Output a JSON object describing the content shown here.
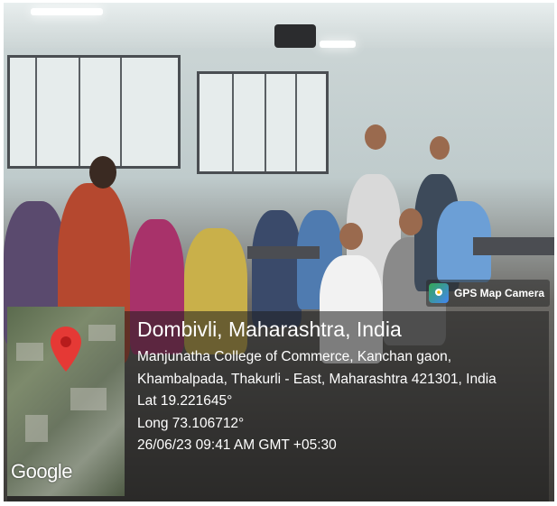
{
  "photo": {
    "subject": "Classroom of students"
  },
  "overlay": {
    "app_badge": "GPS Map Camera",
    "map_attribution": "Google",
    "location_title": "Dombivli, Maharashtra, India",
    "address_line_1": "Manjunatha College of Commerce, Kanchan gaon,",
    "address_line_2": "Khambalpada, Thakurli - East, Maharashtra 421301, India",
    "latitude": "Lat 19.221645°",
    "longitude": "Long 73.106712°",
    "timestamp": "26/06/23 09:41 AM GMT +05:30"
  },
  "colors": {
    "pin": "#e53935",
    "overlay_bg": "rgba(30,30,30,0.55)"
  }
}
